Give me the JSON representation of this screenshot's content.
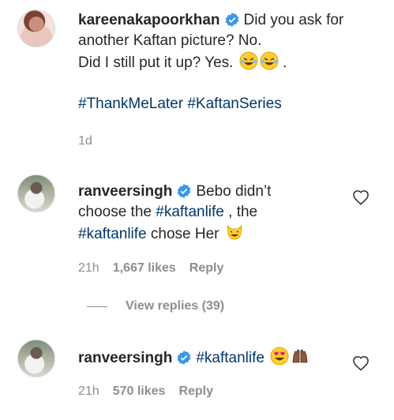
{
  "comments": [
    {
      "username": "kareenakapoorkhan",
      "text_line1": "Did you ask for",
      "text_line2": "another Kaftan picture? No.",
      "text_line3": "Did I still put it up? Yes.",
      "text_line3_suffix": " .",
      "hashtags": [
        "#ThankMeLater",
        "#KaftanSeries"
      ],
      "time": "1d"
    },
    {
      "username": "ranveersingh",
      "text_part1": "Bebo didn’t",
      "text_part2": "choose the",
      "hashtag1": "#kaftanlife",
      "text_part3": " , the",
      "hashtag2": "#kaftanlife",
      "text_part4": " chose Her",
      "time": "21h",
      "likes": "1,667 likes",
      "reply": "Reply",
      "view_replies": "View replies (39)"
    },
    {
      "username": "ranveersingh",
      "hashtag": "#kaftanlife",
      "time": "21h",
      "likes": "570 likes",
      "reply": "Reply"
    }
  ],
  "colors": {
    "text": "#262626",
    "muted": "#8e8e8e",
    "hashtag": "#00376b",
    "verified": "#3897f0"
  },
  "icons": [
    "verified-badge-icon",
    "heart-icon",
    "rofl-emoji",
    "cat-smile-emoji",
    "heart-eyes-emoji",
    "raised-hands-emoji"
  ]
}
